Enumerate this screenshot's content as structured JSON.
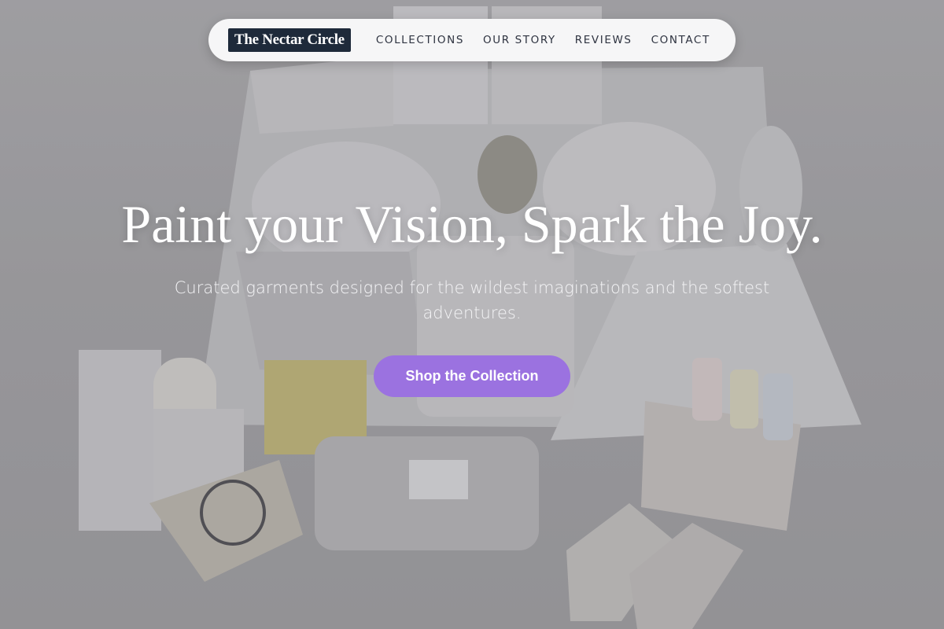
{
  "nav": {
    "brand": "The Nectar Circle",
    "links": [
      {
        "label": "COLLECTIONS"
      },
      {
        "label": "OUR STORY"
      },
      {
        "label": "REVIEWS"
      },
      {
        "label": "CONTACT"
      }
    ]
  },
  "hero": {
    "title": "Paint your Vision, Spark the Joy.",
    "subtitle": "Curated garments designed for the wildest imaginations and the softest adventures.",
    "cta_label": "Shop the Collection"
  },
  "colors": {
    "brand_bg": "#1e2a3a",
    "cta": "#9b72e0",
    "nav_bg": "#f6f6f7"
  }
}
